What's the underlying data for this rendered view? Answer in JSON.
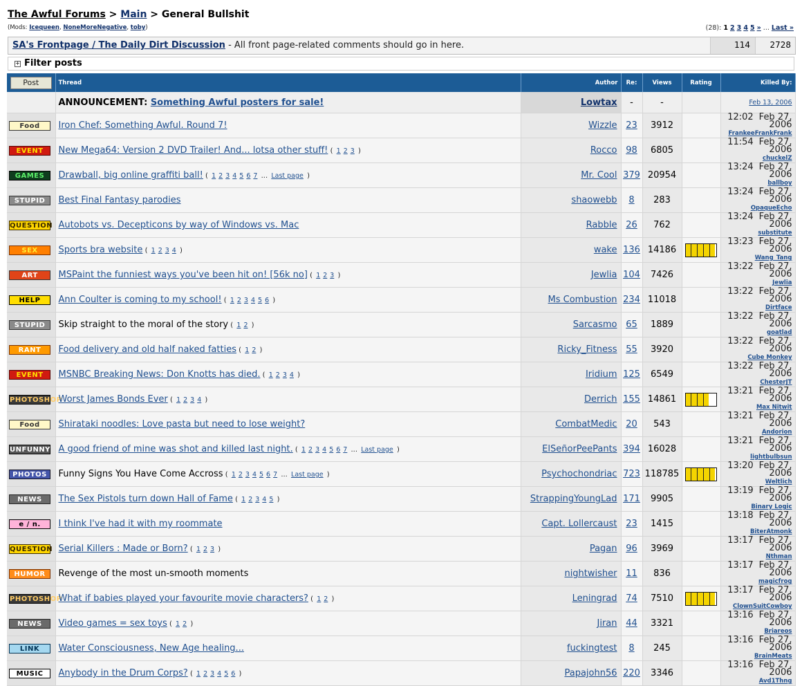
{
  "breadcrumb": {
    "site": "The Awful Forums",
    "sep1": " > ",
    "main": "Main",
    "sep2": " > ",
    "current": "General Bullshit"
  },
  "mods": {
    "prefix": "(Mods: ",
    "names": [
      "Icequeen",
      "NoneMoreNegative",
      "toby"
    ],
    "suffix": ")"
  },
  "pager": {
    "count": "(28):",
    "current": "1",
    "pages": [
      "2",
      "3",
      "4",
      "5"
    ],
    "next": "»",
    "dots": "...",
    "last": "Last »"
  },
  "sticky": {
    "title": "SA's Frontpage / The Daily Dirt Discussion",
    "desc": " - All front page-related comments should go in here.",
    "replies": "114",
    "views": "2728"
  },
  "filter": {
    "label": "Filter posts",
    "toggle": "+"
  },
  "header": {
    "post": "Post",
    "thread": "Thread",
    "author": "Author",
    "re": "Re:",
    "views": "Views",
    "rating": "Rating",
    "killed": "Killed By:"
  },
  "announcement": {
    "prefix": "ANNOUNCEMENT: ",
    "title": "Something Awful posters for sale!",
    "author": "Lowtax",
    "replies": "-",
    "views": "-",
    "date": "Feb 13, 2006"
  },
  "threads": [
    {
      "icon": "Food",
      "title": "Iron Chef: Something Awful. Round 7!",
      "pages": "",
      "author": "Wizzle",
      "replies": "23",
      "views": "3912",
      "rating": 0,
      "time": "12:02",
      "date": "Feb 27, 2006",
      "killed": "FrankeeFrankFrank"
    },
    {
      "icon": "EVENT",
      "title": "New Mega64: Version 2 DVD Trailer! And... lotsa other stuff!",
      "pages": "( 1 2 3 )",
      "author": "Rocco",
      "replies": "98",
      "views": "6805",
      "rating": 0,
      "time": "11:54",
      "date": "Feb 27, 2006",
      "killed": "chuckelZ"
    },
    {
      "icon": "GAMES",
      "title": "Drawball, big online graffiti ball!",
      "pages": "( 1 2 3 4 5 6 7 ... Last page )",
      "author": "Mr. Cool",
      "replies": "379",
      "views": "20954",
      "rating": 0,
      "time": "13:24",
      "date": "Feb 27, 2006",
      "killed": "ballboy"
    },
    {
      "icon": "STUPID",
      "title": "Best Final Fantasy parodies",
      "pages": "",
      "author": "shaowebb",
      "replies": "8",
      "views": "283",
      "rating": 0,
      "time": "13:24",
      "date": "Feb 27, 2006",
      "killed": "OpaqueEcho"
    },
    {
      "icon": "QUESTION",
      "title": "Autobots vs. Decepticons by way of Windows vs. Mac",
      "pages": "",
      "author": "Rabble",
      "replies": "26",
      "views": "762",
      "rating": 0,
      "time": "13:24",
      "date": "Feb 27, 2006",
      "killed": "substitute"
    },
    {
      "icon": "SEX",
      "title": "Sports bra website",
      "pages": "( 1 2 3 4 )",
      "author": "wake",
      "replies": "136",
      "views": "14186",
      "rating": 0.95,
      "time": "13:23",
      "date": "Feb 27, 2006",
      "killed": "Wang_Tang"
    },
    {
      "icon": "ART",
      "title": "MSPaint the funniest ways you've been hit on! [56k no]",
      "pages": "( 1 2 3 )",
      "author": "Jewlia",
      "replies": "104",
      "views": "7426",
      "rating": 0,
      "time": "13:22",
      "date": "Feb 27, 2006",
      "killed": "Jewlia"
    },
    {
      "icon": "HELP",
      "title": "Ann Coulter is coming to my school!",
      "pages": "( 1 2 3 4 5 6 )",
      "author": "Ms Combustion",
      "replies": "234",
      "views": "11018",
      "rating": 0,
      "time": "13:22",
      "date": "Feb 27, 2006",
      "killed": "Dirtface"
    },
    {
      "icon": "STUPID",
      "title": "Skip straight to the moral of the story",
      "pages": "( 1 2 )",
      "author": "Sarcasmo",
      "replies": "65",
      "views": "1889",
      "rating": 0,
      "time": "13:22",
      "date": "Feb 27, 2006",
      "killed": "goatlad",
      "plain": true
    },
    {
      "icon": "RANT",
      "title": "Food delivery and old half naked fatties",
      "pages": "( 1 2 )",
      "author": "Ricky_Fitness",
      "replies": "55",
      "views": "3920",
      "rating": 0,
      "time": "13:22",
      "date": "Feb 27, 2006",
      "killed": "Cube Monkey"
    },
    {
      "icon": "EVENT",
      "title": "MSNBC Breaking News: Don Knotts has died.",
      "pages": "( 1 2 3 4 )",
      "author": "Iridium",
      "replies": "125",
      "views": "6549",
      "rating": 0,
      "time": "13:22",
      "date": "Feb 27, 2006",
      "killed": "ChesterJT"
    },
    {
      "icon": "PHOTOSHOP",
      "title": "Worst James Bonds Ever",
      "pages": "( 1 2 3 4 )",
      "author": "Derrich",
      "replies": "155",
      "views": "14861",
      "rating": 0.75,
      "time": "13:21",
      "date": "Feb 27, 2006",
      "killed": "Max Nitwit"
    },
    {
      "icon": "Food",
      "title": "Shirataki noodles: Love pasta but need to lose weight?",
      "pages": "",
      "author": "CombatMedic",
      "replies": "20",
      "views": "543",
      "rating": 0,
      "time": "13:21",
      "date": "Feb 27, 2006",
      "killed": "Andorion"
    },
    {
      "icon": "UNFUNNY",
      "title": "A good friend of mine was shot and killed last night.",
      "pages": "( 1 2 3 4 5 6 7 ... Last page )",
      "author": "ElSeñorPeePants",
      "replies": "394",
      "views": "16028",
      "rating": 0,
      "time": "13:21",
      "date": "Feb 27, 2006",
      "killed": "lightbulbsun"
    },
    {
      "icon": "PHOTOS",
      "title": "Funny Signs You Have Come Accross",
      "pages": "( 1 2 3 4 5 6 7 ... Last page )",
      "author": "Psychochondriac",
      "replies": "723",
      "views": "118785",
      "rating": 0.95,
      "time": "13:20",
      "date": "Feb 27, 2006",
      "killed": "Weltlich",
      "plain": true
    },
    {
      "icon": "NEWS",
      "title": "The Sex Pistols turn down Hall of Fame",
      "pages": "( 1 2 3 4 5 )",
      "author": "StrappingYoungLad",
      "replies": "171",
      "views": "9905",
      "rating": 0,
      "time": "13:19",
      "date": "Feb 27, 2006",
      "killed": "Binary Logic"
    },
    {
      "icon": "e / n.",
      "title": "I think I've had it with my roommate",
      "pages": "",
      "author": "Capt. Lollercaust",
      "replies": "23",
      "views": "1415",
      "rating": 0,
      "time": "13:18",
      "date": "Feb 27, 2006",
      "killed": "BiterAtmonk"
    },
    {
      "icon": "QUESTION",
      "title": "Serial Killers : Made or Born?",
      "pages": "( 1 2 3 )",
      "author": "Pagan",
      "replies": "96",
      "views": "3969",
      "rating": 0,
      "time": "13:17",
      "date": "Feb 27, 2006",
      "killed": "Nthman"
    },
    {
      "icon": "HUMOR",
      "title": "Revenge of the most un-smooth moments",
      "pages": "",
      "author": "nightwisher",
      "replies": "11",
      "views": "836",
      "rating": 0,
      "time": "13:17",
      "date": "Feb 27, 2006",
      "killed": "magicfrog",
      "plain": true
    },
    {
      "icon": "PHOTOSHOP",
      "title": "What if babies played your favourite movie characters?",
      "pages": "( 1 2 )",
      "author": "Leningrad",
      "replies": "74",
      "views": "7510",
      "rating": 0.95,
      "time": "13:17",
      "date": "Feb 27, 2006",
      "killed": "ClownSuitCowboy"
    },
    {
      "icon": "NEWS",
      "title": "Video games = sex toys",
      "pages": "( 1 2 )",
      "author": "Jiran",
      "replies": "44",
      "views": "3321",
      "rating": 0,
      "time": "13:16",
      "date": "Feb 27, 2006",
      "killed": "Briareos"
    },
    {
      "icon": "LINK",
      "title": "Water Consciousness, New Age healing...",
      "pages": "",
      "author": "fuckingtest",
      "replies": "8",
      "views": "245",
      "rating": 0,
      "time": "13:16",
      "date": "Feb 27, 2006",
      "killed": "BrainMeats"
    },
    {
      "icon": "MUSIC",
      "title": "Anybody in the Drum Corps?",
      "pages": "( 1 2 3 4 5 6 )",
      "author": "Papajohn56",
      "replies": "220",
      "views": "3346",
      "rating": 0,
      "time": "13:16",
      "date": "Feb 27, 2006",
      "killed": "Avd1Thng"
    }
  ],
  "icon_styles": {
    "Food": {
      "bg": "#fff8c8",
      "fg": "#333",
      "border": "#333",
      "name": "food-icon"
    },
    "EVENT": {
      "bg": "#d01a10",
      "fg": "#ffe000",
      "border": "#500",
      "name": "event-icon"
    },
    "GAMES": {
      "bg": "#0e3d1e",
      "fg": "#5cf06a",
      "border": "#000",
      "name": "games-icon"
    },
    "STUPID": {
      "bg": "#8a8a8a",
      "fg": "#ffffff",
      "border": "#333",
      "name": "stupid-icon"
    },
    "QUESTION": {
      "bg": "#ffd600",
      "fg": "#3a2a00",
      "border": "#3a2a00",
      "name": "question-icon"
    },
    "SEX": {
      "bg": "#ff7f00",
      "fg": "#ffee33",
      "border": "#7a3000",
      "name": "sex-icon"
    },
    "ART": {
      "bg": "#e04418",
      "fg": "#ffffff",
      "border": "#333",
      "name": "art-icon"
    },
    "HELP": {
      "bg": "#ffde00",
      "fg": "#000000",
      "border": "#000",
      "name": "help-icon"
    },
    "RANT": {
      "bg": "#ff9a00",
      "fg": "#ffffff",
      "border": "#7a3000",
      "name": "rant-icon"
    },
    "PHOTOSHOP": {
      "bg": "#3a3a3a",
      "fg": "#ffcc66",
      "border": "#000",
      "name": "photoshop-icon"
    },
    "UNFUNNY": {
      "bg": "#555555",
      "fg": "#ffffff",
      "border": "#000",
      "name": "unfunny-icon"
    },
    "PHOTOS": {
      "bg": "#4455aa",
      "fg": "#ffffff",
      "border": "#112",
      "name": "photos-icon"
    },
    "NEWS": {
      "bg": "#6a6a6a",
      "fg": "#ffffff",
      "border": "#222",
      "name": "news-icon"
    },
    "e / n.": {
      "bg": "#ffb3d9",
      "fg": "#000000",
      "border": "#000",
      "name": "e-n-icon"
    },
    "HUMOR": {
      "bg": "#ff8c1a",
      "fg": "#ffffff",
      "border": "#7a3000",
      "name": "humor-icon"
    },
    "LINK": {
      "bg": "#a5d8f0",
      "fg": "#003355",
      "border": "#003355",
      "name": "link-icon"
    },
    "MUSIC": {
      "bg": "#ffffff",
      "fg": "#000000",
      "border": "#000",
      "name": "music-icon"
    }
  }
}
